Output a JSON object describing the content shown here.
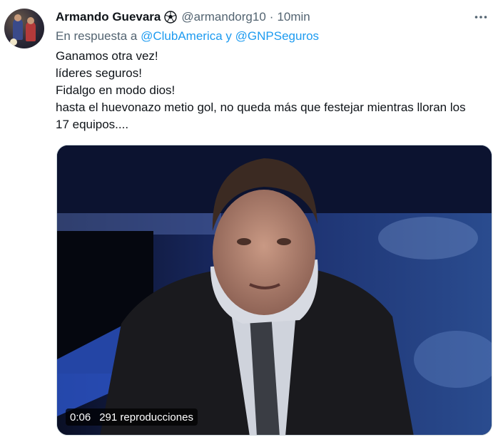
{
  "tweet": {
    "author_name": "Armando Guevara",
    "author_icon": "soccer-ball-icon",
    "handle": "@armandorg10",
    "separator": "·",
    "time": "10min",
    "reply_prefix": "En respuesta a",
    "reply_to_1": "@ClubAmerica",
    "reply_conj": "y",
    "reply_to_2": "@GNPSeguros",
    "text_lines": [
      "Ganamos otra vez!",
      "líderes seguros!",
      "Fidalgo en modo dios!",
      "hasta el huevonazo metio gol, no queda más que festejar mientras lloran los",
      "17 equipos...."
    ],
    "video": {
      "duration": "0:06",
      "views": "291 reproducciones"
    }
  },
  "colors": {
    "text_primary": "#0f1419",
    "text_secondary": "#536471",
    "link": "#1d9bf0"
  }
}
